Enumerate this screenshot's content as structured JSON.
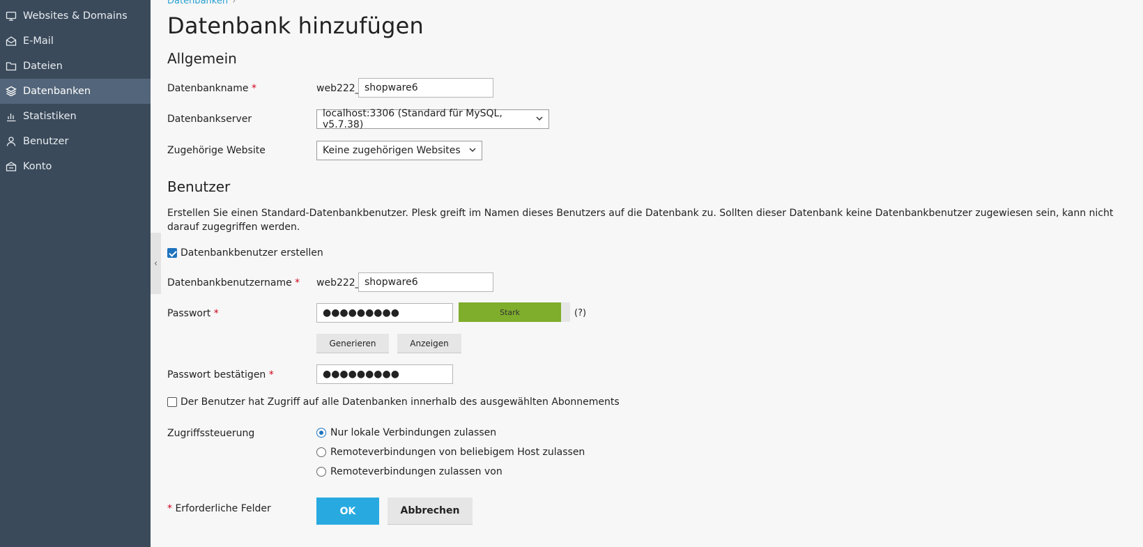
{
  "sidebar": {
    "items": [
      {
        "label": "Websites & Domains",
        "icon": "monitor-icon"
      },
      {
        "label": "E-Mail",
        "icon": "mail-icon"
      },
      {
        "label": "Dateien",
        "icon": "folder-icon"
      },
      {
        "label": "Datenbanken",
        "icon": "database-icon",
        "active": true
      },
      {
        "label": "Statistiken",
        "icon": "bar-chart-icon"
      },
      {
        "label": "Benutzer",
        "icon": "user-icon"
      },
      {
        "label": "Konto",
        "icon": "account-icon"
      }
    ]
  },
  "breadcrumb": {
    "item": "Datenbanken",
    "separator": "›"
  },
  "page": {
    "title": "Datenbank hinzufügen"
  },
  "general": {
    "heading": "Allgemein",
    "db_name_label": "Datenbankname",
    "db_name_prefix": "web222_",
    "db_name_value": "shopware6",
    "db_server_label": "Datenbankserver",
    "db_server_value": "localhost:3306 (Standard für MySQL, v5.7.38)",
    "website_label": "Zugehörige Website",
    "website_value": "Keine zugehörigen Websites"
  },
  "user": {
    "heading": "Benutzer",
    "description": "Erstellen Sie einen Standard-Datenbankbenutzer. Plesk greift im Namen dieses Benutzers auf die Datenbank zu. Sollten dieser Datenbank keine Datenbankbenutzer zugewiesen sein, kann nicht darauf zugegriffen werden.",
    "create_user_label": "Datenbankbenutzer erstellen",
    "create_user_checked": true,
    "username_label": "Datenbankbenutzername",
    "username_prefix": "web222_",
    "username_value": "shopware6",
    "password_label": "Passwort",
    "password_value": "●●●●●●●●●",
    "strength_label": "Stark",
    "strength_level": 0.92,
    "strength_color": "#7fad2c",
    "help_label": "(?)",
    "generate_label": "Generieren",
    "show_label": "Anzeigen",
    "confirm_label": "Passwort bestätigen",
    "confirm_value": "●●●●●●●●●",
    "all_dbs_label": "Der Benutzer hat Zugriff auf alle Datenbanken innerhalb des ausgewählten Abonnements",
    "all_dbs_checked": false,
    "access_label": "Zugriffssteuerung",
    "access_options": [
      {
        "label": "Nur lokale Verbindungen zulassen",
        "selected": true
      },
      {
        "label": "Remoteverbindungen von beliebigem Host zulassen",
        "selected": false
      },
      {
        "label": "Remoteverbindungen zulassen von",
        "selected": false
      }
    ]
  },
  "footer": {
    "required_star": "*",
    "required_label": "Erforderliche Felder",
    "ok_label": "OK",
    "cancel_label": "Abbrechen"
  },
  "required_mark": "*",
  "colors": {
    "accent": "#28aae1",
    "sidebar": "#3b4a5a",
    "sidebar_active": "#53657a",
    "required": "#d0021b"
  }
}
